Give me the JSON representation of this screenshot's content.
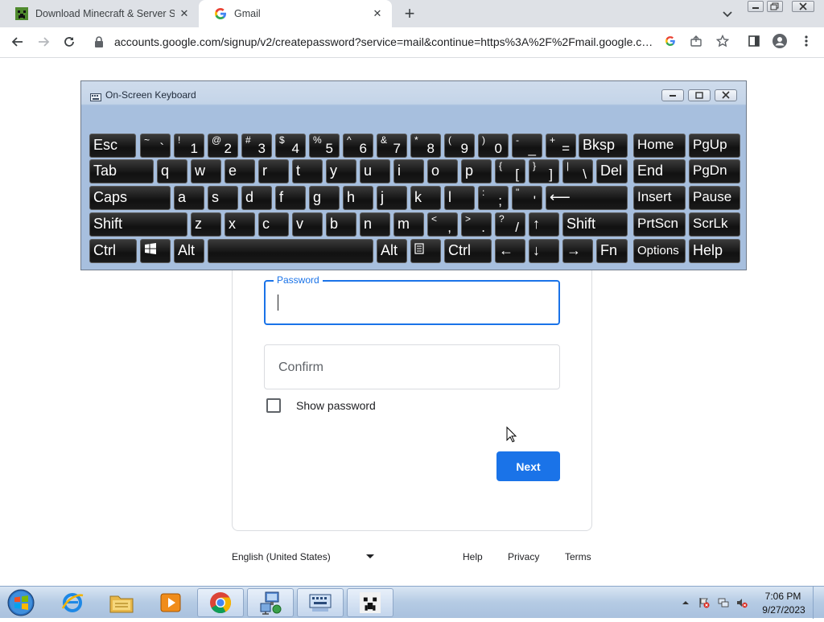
{
  "browser": {
    "tabs": [
      {
        "title": "Download Minecraft & Server Software",
        "active": false,
        "favicon": "minecraft-icon"
      },
      {
        "title": "Gmail",
        "active": true,
        "favicon": "google-g-icon"
      }
    ],
    "url": "accounts.google.com/signup/v2/createpassword?service=mail&continue=https%3A%2F%2Fmail.google.co..."
  },
  "page": {
    "password_label": "Password",
    "password_value": "",
    "confirm_placeholder": "Confirm",
    "show_password_label": "Show password",
    "show_password_checked": false,
    "next_label": "Next",
    "footer": {
      "language": "English (United States)",
      "links": [
        "Help",
        "Privacy",
        "Terms"
      ]
    },
    "colors": {
      "accent": "#1a73e8",
      "text": "#202124",
      "border": "#dadce0"
    }
  },
  "osk": {
    "title": "On-Screen Keyboard",
    "rows": [
      [
        {
          "main": "Esc"
        },
        {
          "shift": "~",
          "main": "`"
        },
        {
          "shift": "!",
          "main": "1"
        },
        {
          "shift": "@",
          "main": "2"
        },
        {
          "shift": "#",
          "main": "3"
        },
        {
          "shift": "$",
          "main": "4"
        },
        {
          "shift": "%",
          "main": "5"
        },
        {
          "shift": "^",
          "main": "6"
        },
        {
          "shift": "&",
          "main": "7"
        },
        {
          "shift": "*",
          "main": "8"
        },
        {
          "shift": "(",
          "main": "9"
        },
        {
          "shift": ")",
          "main": "0"
        },
        {
          "shift": "-",
          "main": "_"
        },
        {
          "shift": "+",
          "main": "="
        },
        {
          "main": "Bksp"
        },
        {
          "main": "Home"
        },
        {
          "main": "PgUp"
        }
      ],
      [
        {
          "main": "Tab"
        },
        {
          "main": "q"
        },
        {
          "main": "w"
        },
        {
          "main": "e"
        },
        {
          "main": "r"
        },
        {
          "main": "t"
        },
        {
          "main": "y"
        },
        {
          "main": "u"
        },
        {
          "main": "i"
        },
        {
          "main": "o"
        },
        {
          "main": "p"
        },
        {
          "shift": "{",
          "main": "["
        },
        {
          "shift": "}",
          "main": "]"
        },
        {
          "shift": "|",
          "main": "\\"
        },
        {
          "main": "Del"
        },
        {
          "main": "End"
        },
        {
          "main": "PgDn"
        }
      ],
      [
        {
          "main": "Caps"
        },
        {
          "main": "a"
        },
        {
          "main": "s"
        },
        {
          "main": "d"
        },
        {
          "main": "f"
        },
        {
          "main": "g"
        },
        {
          "main": "h"
        },
        {
          "main": "j"
        },
        {
          "main": "k"
        },
        {
          "main": "l"
        },
        {
          "shift": ":",
          "main": ";"
        },
        {
          "shift": "\"",
          "main": "'"
        },
        {
          "main": "⟵"
        },
        {
          "main": "Insert"
        },
        {
          "main": "Pause"
        }
      ],
      [
        {
          "main": "Shift"
        },
        {
          "main": "z"
        },
        {
          "main": "x"
        },
        {
          "main": "c"
        },
        {
          "main": "v"
        },
        {
          "main": "b"
        },
        {
          "main": "n"
        },
        {
          "main": "m"
        },
        {
          "shift": "<",
          "main": ","
        },
        {
          "shift": ">",
          "main": "."
        },
        {
          "shift": "?",
          "main": "/"
        },
        {
          "main": "↑"
        },
        {
          "main": "Shift"
        },
        {
          "main": "PrtScn"
        },
        {
          "main": "ScrLk"
        }
      ],
      [
        {
          "main": "Ctrl"
        },
        {
          "main": "",
          "icon": "windows-logo-icon"
        },
        {
          "main": "Alt"
        },
        {
          "main": ""
        },
        {
          "main": "Alt"
        },
        {
          "main": "",
          "icon": "menu-key-icon"
        },
        {
          "main": "Ctrl"
        },
        {
          "main": "←"
        },
        {
          "main": "↓"
        },
        {
          "main": "→"
        },
        {
          "main": "Fn"
        },
        {
          "main": "Options"
        },
        {
          "main": "Help"
        }
      ]
    ]
  },
  "taskbar": {
    "pinned": [
      "internet-explorer-icon",
      "file-explorer-icon",
      "media-player-icon",
      "chrome-icon",
      "network-icon",
      "on-screen-keyboard-icon",
      "minecraft-icon"
    ],
    "clock_time": "7:06 PM",
    "clock_date": "9/27/2023"
  }
}
